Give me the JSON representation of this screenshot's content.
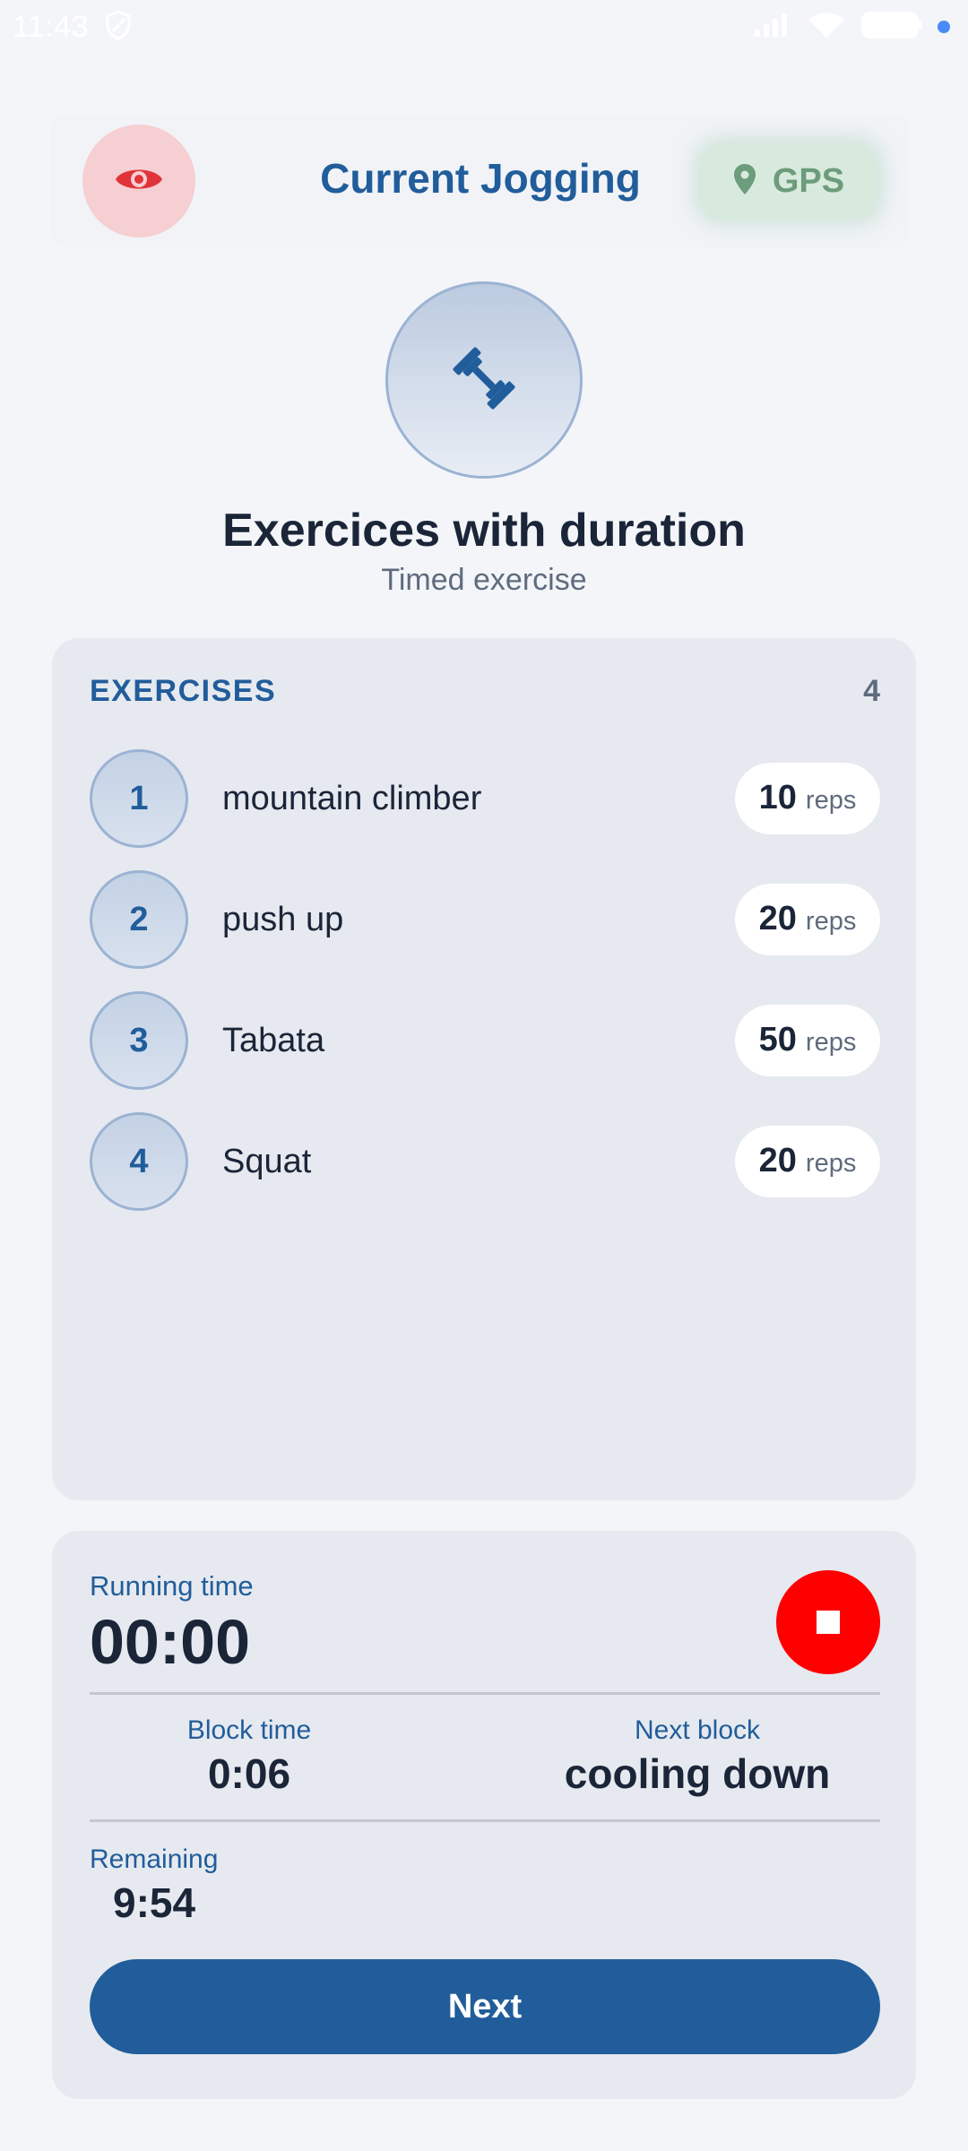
{
  "status_bar": {
    "time": "11:43",
    "icons": [
      "shield-icon",
      "signal-icon",
      "wifi-icon",
      "battery-icon"
    ]
  },
  "header": {
    "title": "Current Jogging",
    "visibility_icon": "eye-icon",
    "gps_label": "GPS",
    "gps_icon": "location-pin-icon"
  },
  "block": {
    "icon": "dumbbell-icon",
    "title": "Exercices with duration",
    "subtitle": "Timed exercise"
  },
  "exercises": {
    "heading": "EXERCISES",
    "count": "4",
    "items": [
      {
        "number": "1",
        "name": "mountain climber",
        "reps": "10",
        "unit": "reps"
      },
      {
        "number": "2",
        "name": "push up",
        "reps": "20",
        "unit": "reps"
      },
      {
        "number": "3",
        "name": "Tabata",
        "reps": "50",
        "unit": "reps"
      },
      {
        "number": "4",
        "name": "Squat",
        "reps": "20",
        "unit": "reps"
      }
    ]
  },
  "timer": {
    "running_label": "Running time",
    "running_value": "00:00",
    "block_time_label": "Block time",
    "block_time_value": "0:06",
    "next_block_label": "Next block",
    "next_block_value": "cooling down",
    "remaining_label": "Remaining",
    "remaining_value": "9:54",
    "next_button": "Next"
  },
  "colors": {
    "primary": "#215d9b",
    "stop": "#ff0000",
    "gps_bg": "#d8eadd",
    "eye_bg": "#f6cfd2",
    "eye_icon": "#e0343a"
  }
}
